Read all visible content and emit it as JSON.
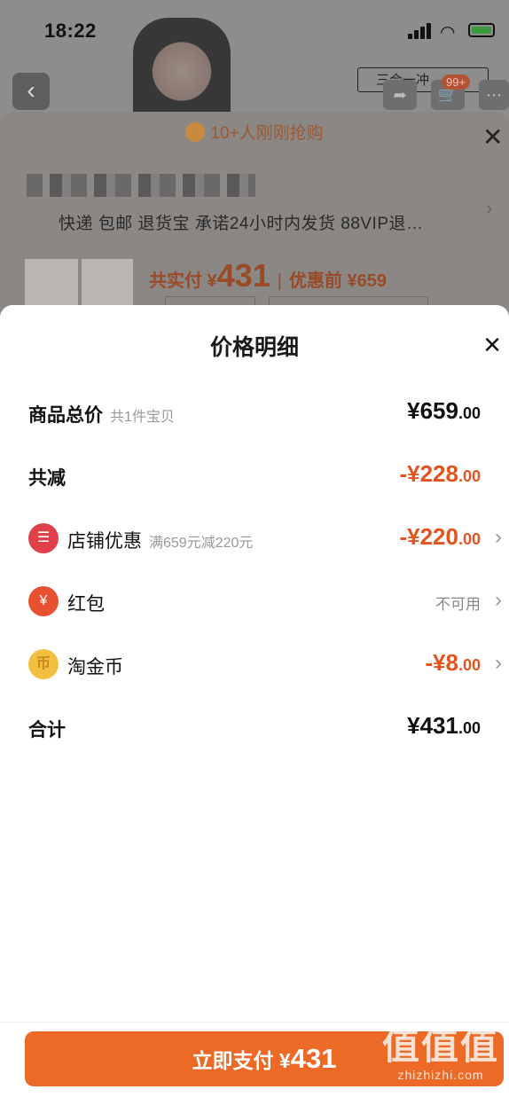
{
  "status_bar": {
    "time": "18:22"
  },
  "background_page": {
    "shop_tag": "三合一冲",
    "cart_badge": "99+",
    "banner": "10+人刚刚抢购",
    "services": "快递 包邮 退货宝 承诺24小时内发货 88VIP退…",
    "total_paid_label": "共实付 ¥",
    "total_paid_value": "431",
    "before_discount": "优惠前 ¥659"
  },
  "sheet": {
    "title": "价格明细",
    "rows": [
      {
        "label": "商品总价",
        "sub": "共1件宝贝",
        "value_main": "¥659",
        "value_dec": ".00",
        "icon": ""
      },
      {
        "label": "共减",
        "sub": "",
        "value_main": "-¥228",
        "value_dec": ".00",
        "icon": ""
      },
      {
        "label": "店铺优惠",
        "sub": "满659元减220元",
        "value_main": "-¥220",
        "value_dec": ".00",
        "icon": "shop-icon"
      },
      {
        "label": "红包",
        "sub": "",
        "value_text": "不可用",
        "icon": "red-packet-icon"
      },
      {
        "label": "淘金币",
        "sub": "",
        "value_main": "-¥8",
        "value_dec": ".00",
        "icon": "gold-coin-icon"
      },
      {
        "label": "合计",
        "sub": "",
        "value_main": "¥431",
        "value_dec": ".00",
        "icon": ""
      }
    ],
    "pay_button": {
      "label": "立即支付 ¥",
      "amount": "431"
    }
  },
  "watermark": {
    "main": "值值值",
    "sub": "zhizhizhi.com"
  },
  "colors": {
    "accent": "#ec6a25",
    "discount": "#e5541f"
  }
}
